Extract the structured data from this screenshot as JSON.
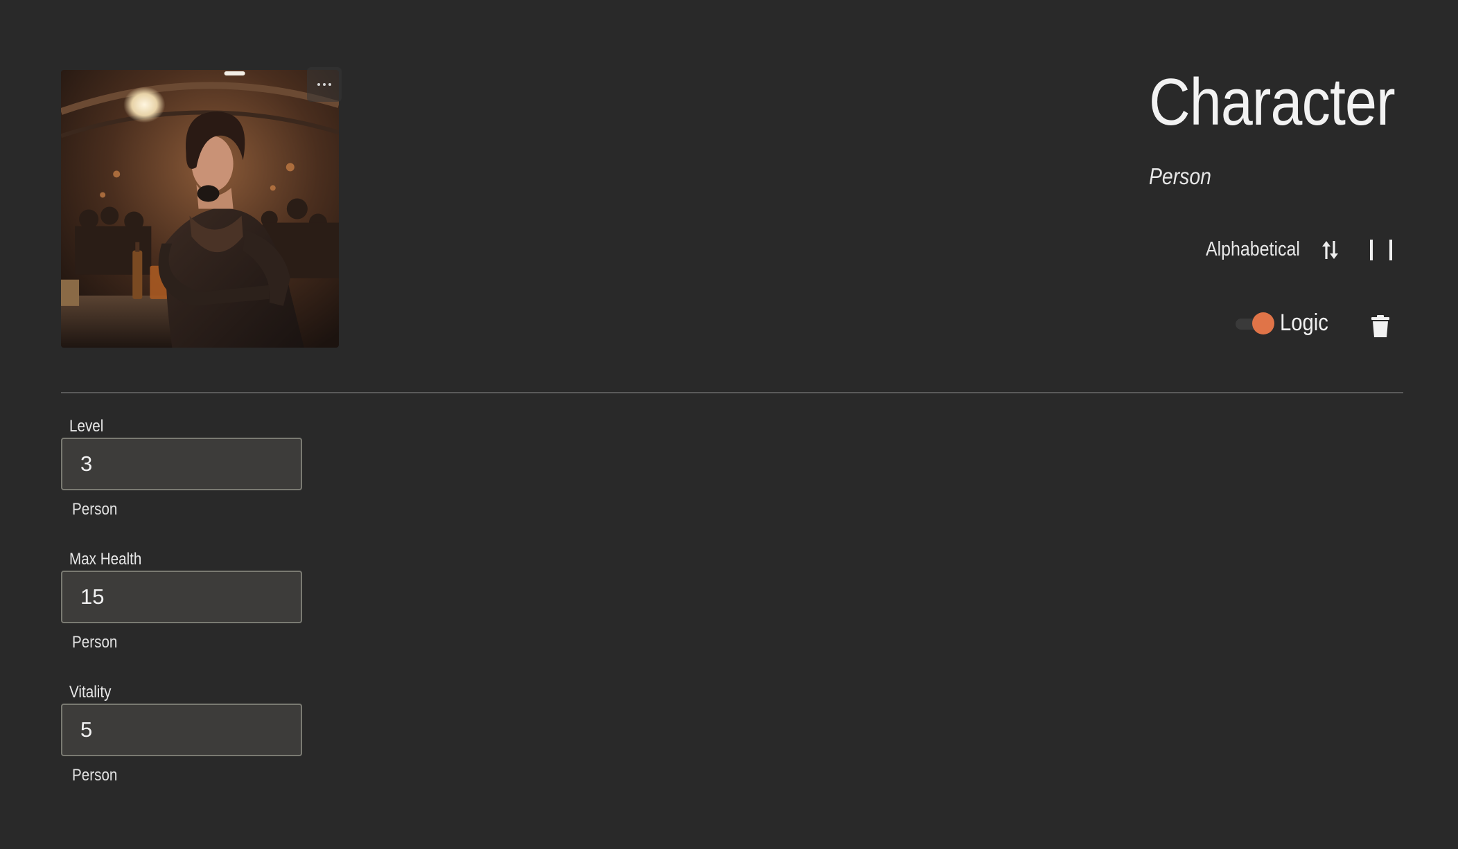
{
  "header": {
    "title": "Character",
    "subtitle": "Person"
  },
  "portrait": {
    "alt": "character-portrait-image",
    "more_icon": "more-horizontal-icon"
  },
  "toolbar": {
    "sort_label": "Alphabetical",
    "sort_icon": "sort-swap-icon",
    "columns_icon": "columns-pipe-icon",
    "toggle_label": "Logic",
    "toggle_on": true,
    "toggle_color": "#e07448",
    "delete_icon": "trash-icon"
  },
  "fields": [
    {
      "label": "Level",
      "value": "3",
      "helper": "Person"
    },
    {
      "label": "Max Health",
      "value": "15",
      "helper": "Person"
    },
    {
      "label": "Vitality",
      "value": "5",
      "helper": "Person"
    }
  ],
  "colors": {
    "background": "#292929",
    "input_background": "#3d3c3a",
    "input_border": "#7a7a72",
    "accent": "#e07448"
  }
}
